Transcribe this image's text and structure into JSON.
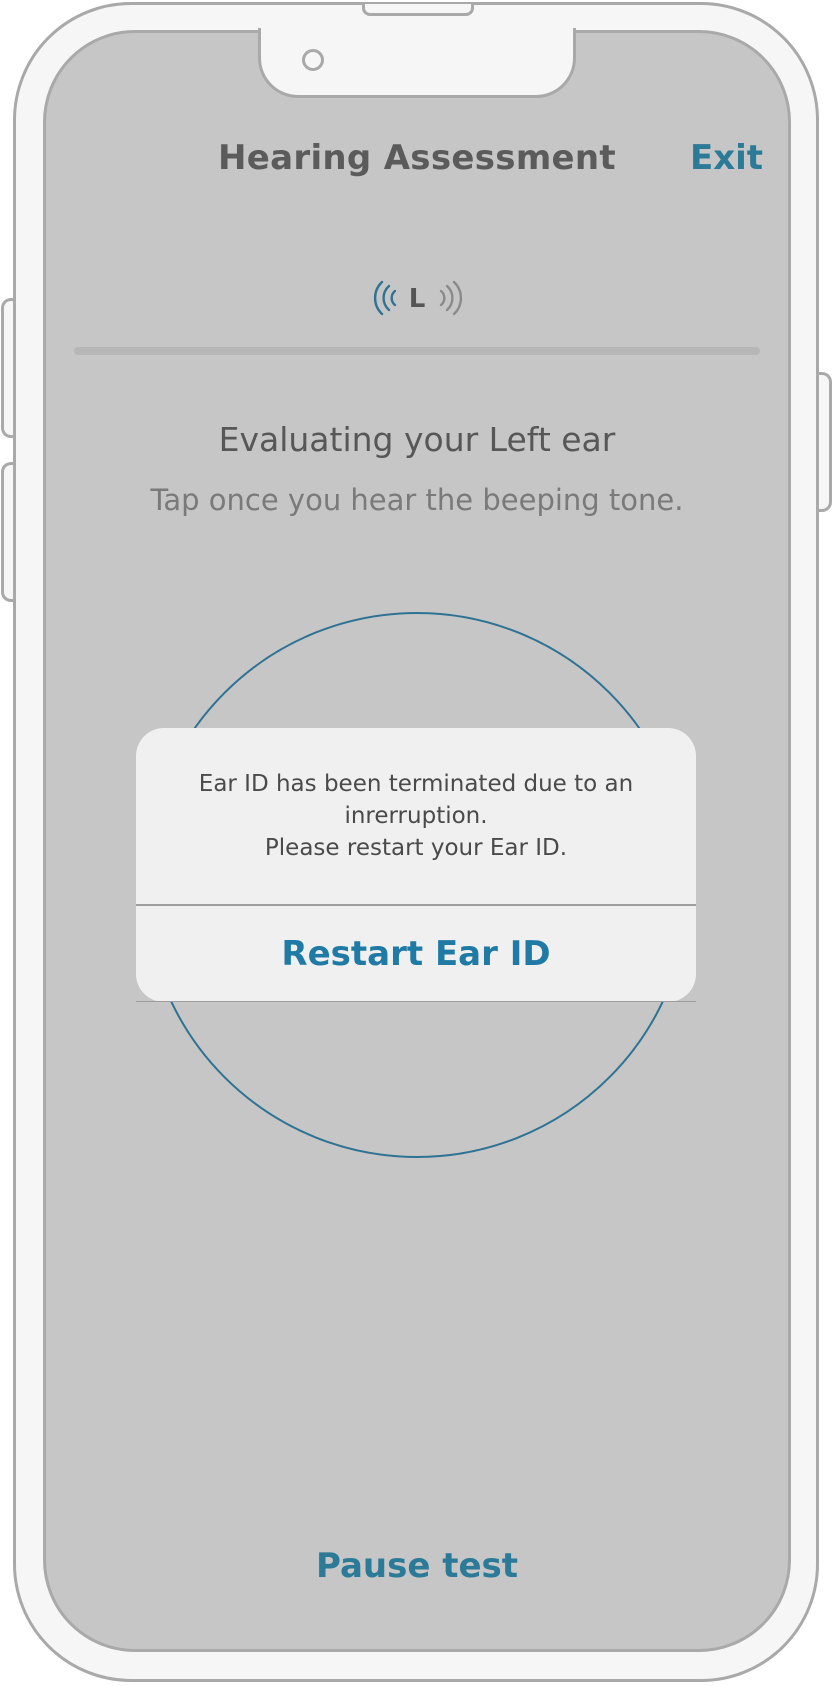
{
  "header": {
    "title": "Hearing Assessment",
    "exit_label": "Exit"
  },
  "ear_indicator": {
    "letter": "L",
    "icon": "sound-waves-icon",
    "active_side": "left"
  },
  "progress": {
    "fraction": 0
  },
  "evaluation": {
    "title": "Evaluating your Left ear",
    "instruction": "Tap once you hear the beeping tone."
  },
  "alert": {
    "message_line1": "Ear ID has been terminated due to an",
    "message_line2": "inrerruption.",
    "message_line3": "Please restart your Ear ID.",
    "action_label": "Restart Ear ID"
  },
  "footer": {
    "pause_label": "Pause test"
  },
  "colors": {
    "accent": "#2b7a98",
    "alert_action": "#1f7aa5",
    "screen_bg": "#c6c6c6",
    "frame": "#a9a9a9"
  }
}
